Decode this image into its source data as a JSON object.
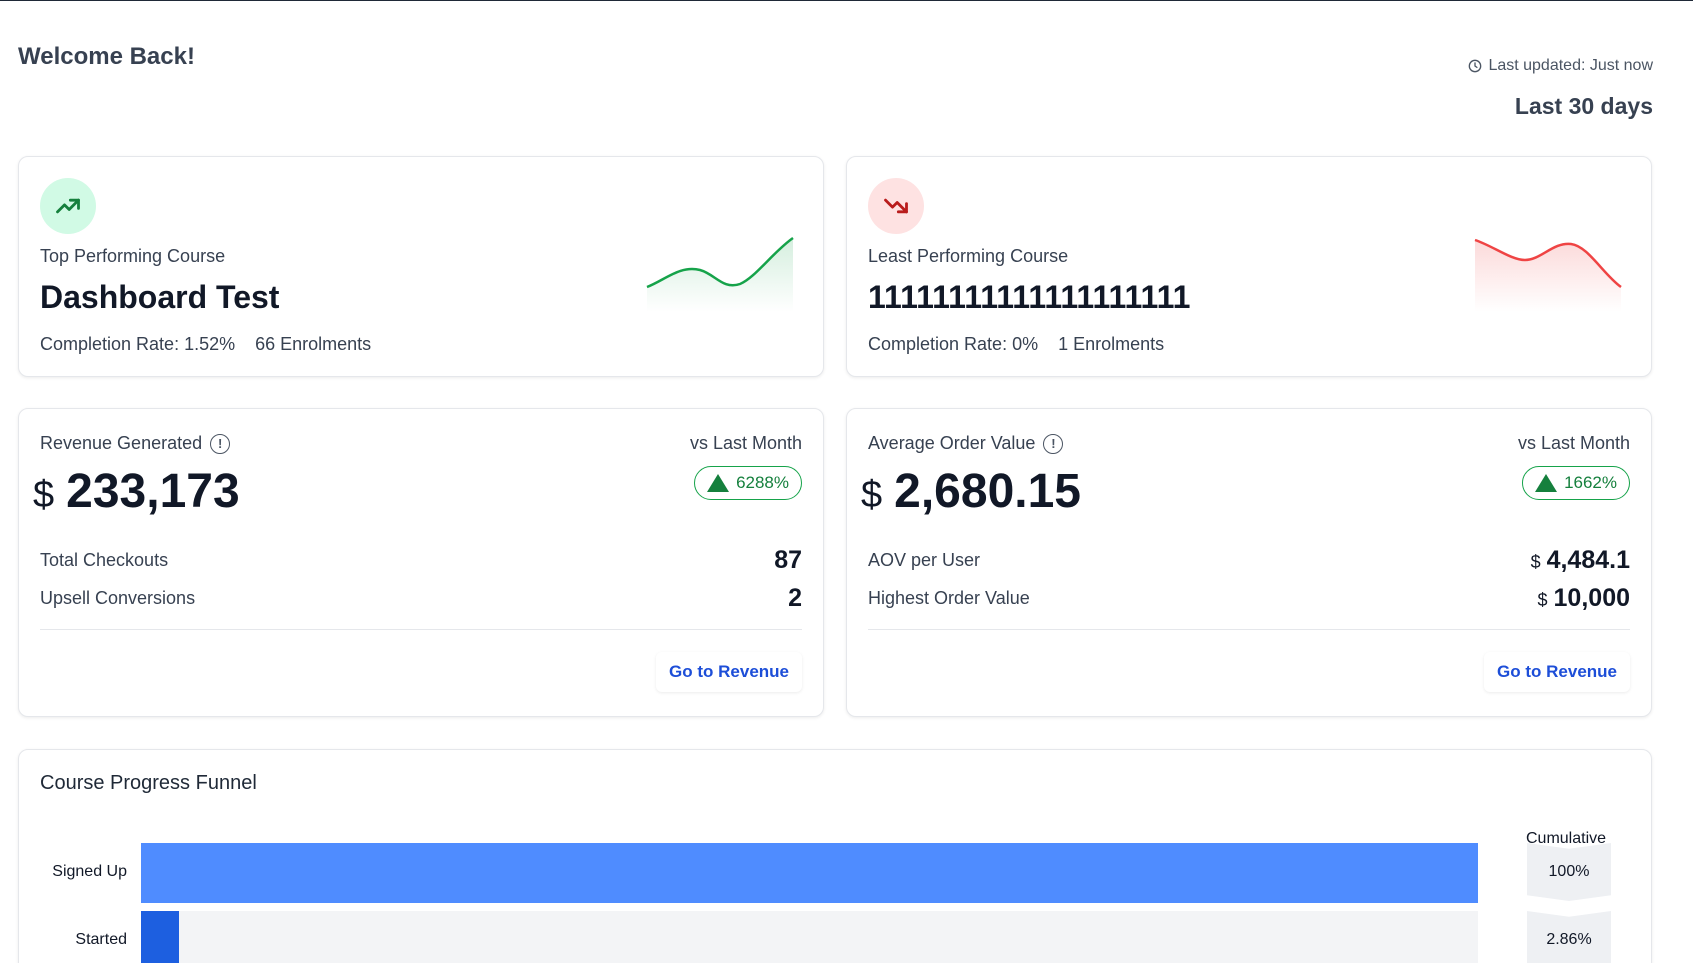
{
  "header": {
    "welcome": "Welcome Back!",
    "last_updated": "Last updated: Just now",
    "range": "Last 30 days"
  },
  "top_course": {
    "label": "Top Performing Course",
    "name": "Dashboard Test",
    "completion": "Completion Rate: 1.52%",
    "enrolments": "66 Enrolments",
    "trend_color": "#16a34a"
  },
  "least_course": {
    "label": "Least Performing Course",
    "name": "11111111111111111111",
    "completion": "Completion Rate: 0%",
    "enrolments": "1 Enrolments",
    "trend_color": "#ef4444"
  },
  "revenue": {
    "label": "Revenue Generated",
    "vs": "vs Last Month",
    "change": "6288%",
    "currency": "$",
    "value": "233,173",
    "rows": [
      {
        "key": "Total Checkouts",
        "value": "87"
      },
      {
        "key": "Upsell Conversions",
        "value": "2"
      }
    ],
    "button": "Go to Revenue"
  },
  "aov": {
    "label": "Average Order Value",
    "vs": "vs Last Month",
    "change": "1662%",
    "currency": "$",
    "value": "2,680.15",
    "rows": [
      {
        "key": "AOV per User",
        "currency": "$",
        "value": "4,484.1"
      },
      {
        "key": "Highest Order Value",
        "currency": "$",
        "value": "10,000"
      }
    ],
    "button": "Go to Revenue"
  },
  "funnel": {
    "title": "Course Progress Funnel",
    "cumulative_header": "Cumulative",
    "fill_color": "#4f8cff",
    "fill_color_dark": "#1d5fe0",
    "stages": [
      {
        "label": "Signed Up",
        "fraction": 1.0,
        "cumulative": "100%"
      },
      {
        "label": "Started",
        "fraction": 0.0286,
        "cumulative": "2.86%"
      }
    ]
  }
}
